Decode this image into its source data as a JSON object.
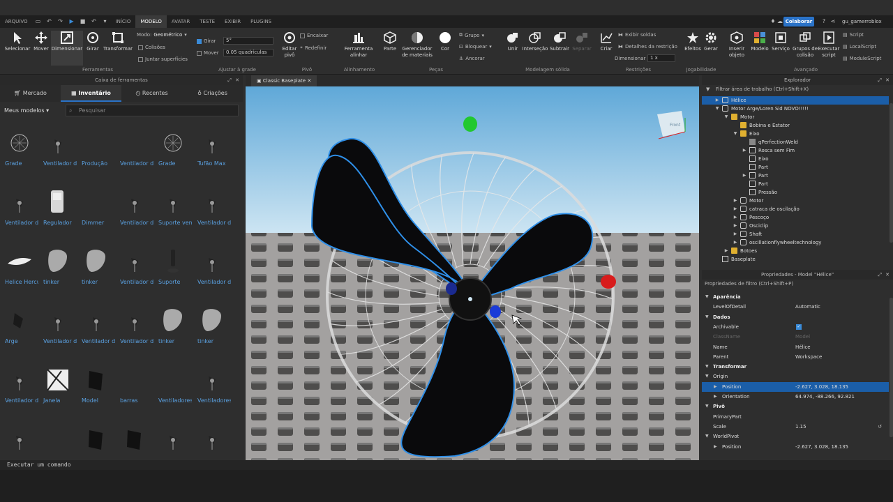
{
  "titlebar": {
    "menus": [
      "ARQUIVO",
      "INÍCIO",
      "MODELO",
      "AVATAR",
      "TESTE",
      "EXIBIR",
      "PLUGINS"
    ],
    "active": "MODELO",
    "collab": "Colaborar",
    "user": "gu_gamerroblox"
  },
  "ribbon": {
    "tools": [
      "Selecionar",
      "Mover",
      "Dimensionar",
      "Girar",
      "Transformar"
    ],
    "mode_label": "Modo:",
    "mode_value": "Geométrico",
    "collisions": "Colisões",
    "join_surfaces": "Juntar superfícies",
    "rotate_label": "Girar",
    "rotate_value": "5°",
    "move_label": "Mover",
    "move_value": "0.05 quadrículas",
    "pivot_edit": "Editar pivô",
    "pivot_snap": "Encaixar",
    "pivot_reset": "Redefinir",
    "align": "Ferramenta alinhar",
    "part": "Parte",
    "materials": "Gerenciador de materiais",
    "color": "Cor",
    "group": "Grupo",
    "lock": "Bloquear",
    "anchor": "Ancorar",
    "union": "Unir",
    "intersect": "Interseção",
    "subtract": "Subtrair",
    "separate": "Separar",
    "create": "Criar",
    "show_welds": "Exibir soldas",
    "constraint_details": "Detalhes da restrição",
    "scale_label": "Dimensionar",
    "scale_value": "1 x",
    "effects": "Efeitos",
    "manage": "Gerar",
    "insert_object": "Inserir objeto",
    "model": "Modelo",
    "service": "Serviço",
    "collision_groups": "Grupos de colisão",
    "run_script": "Executar script",
    "script": "Script",
    "localscript": "LocalScript",
    "modulescript": "ModuleScript",
    "groups": [
      "Ferramentas",
      "Ajustar à grade",
      "Pivô",
      "Alinhamento",
      "Peças",
      "Modelagem sólida",
      "Restrições",
      "Jogabilidade",
      "Avançado"
    ]
  },
  "toolbox": {
    "title": "Caixa de ferramentas",
    "tabs": [
      "Mercado",
      "Inventário",
      "Recentes",
      "Criações"
    ],
    "filter": "Meus modelos",
    "search_placeholder": "Pesquisar",
    "items": [
      "Grade",
      "Ventilador de Parede-...",
      "Produção",
      "Ventilador de Parede-...",
      "Grade",
      "Tufão Max",
      "Ventilador de Parede-...",
      "Regulador",
      "Dimmer",
      "Ventilador de Parede-...",
      "Suporte ventisol-...",
      "Ventilador de Parede-...",
      "Helice Hercules",
      "tinker",
      "tinker",
      "Ventilador de Parede-...",
      "Suporte",
      "Ventilador de coluna-...",
      "Arge",
      "Ventilador de Parede-...",
      "Ventilador de Parede-...",
      "Ventilador de Parede-...",
      "tinker",
      "tinker",
      "Ventilador de Coluna-...",
      "Janela",
      "Model",
      "barras",
      "Ventiladores de Parede-...",
      "Ventiladores de Parede-...",
      "",
      "",
      "",
      "",
      "",
      ""
    ]
  },
  "viewport": {
    "tab": "Classic Baseplate",
    "cube_label": "Front"
  },
  "command": "Executar um comando",
  "explorer": {
    "title": "Explorador",
    "filter": "Filtrar área de trabalho (Ctrl+Shift+X)",
    "rows": [
      "Hélice",
      "Motor Arge/Loren Sid NOVO!!!!!",
      "Motor",
      "Bobina e Estator",
      "Eixo",
      "qPerfectionWeld",
      "Rosca sem Fim",
      "Eixo",
      "Part",
      "Part",
      "Part",
      "Pressão",
      "Motor",
      "catraca de oscilação",
      "Pescoço",
      "Osciclip",
      "Shaft",
      "oscillationflywheeltechnology",
      "Botoes",
      "Baseplate"
    ]
  },
  "properties": {
    "title": "Propriedades - Model \"Hélice\"",
    "filter": "Propriedades de filtro (Ctrl+Shift+P)",
    "rows": [
      {
        "k": "Aparência",
        "v": ""
      },
      {
        "k": "LevelOfDetail",
        "v": "Automatic"
      },
      {
        "k": "Dados",
        "v": ""
      },
      {
        "k": "Archivable",
        "v": ""
      },
      {
        "k": "ClassName",
        "v": "Model"
      },
      {
        "k": "Name",
        "v": "Hélice"
      },
      {
        "k": "Parent",
        "v": "Workspace"
      },
      {
        "k": "Transformar",
        "v": ""
      },
      {
        "k": "Origin",
        "v": ""
      },
      {
        "k": "Position",
        "v": "-2.627, 3.028, 18.135"
      },
      {
        "k": "Orientation",
        "v": "64.974, -88.266, 92.821"
      },
      {
        "k": "Pivô",
        "v": ""
      },
      {
        "k": "PrimaryPart",
        "v": ""
      },
      {
        "k": "Scale",
        "v": "1.15"
      },
      {
        "k": "WorldPivot",
        "v": ""
      },
      {
        "k": "Position",
        "v": "-2.627, 3.028, 18.135"
      }
    ]
  },
  "colors": {
    "accent": "#2a73c9",
    "selection": "#1b5ea8",
    "link": "#5aa0e0"
  }
}
